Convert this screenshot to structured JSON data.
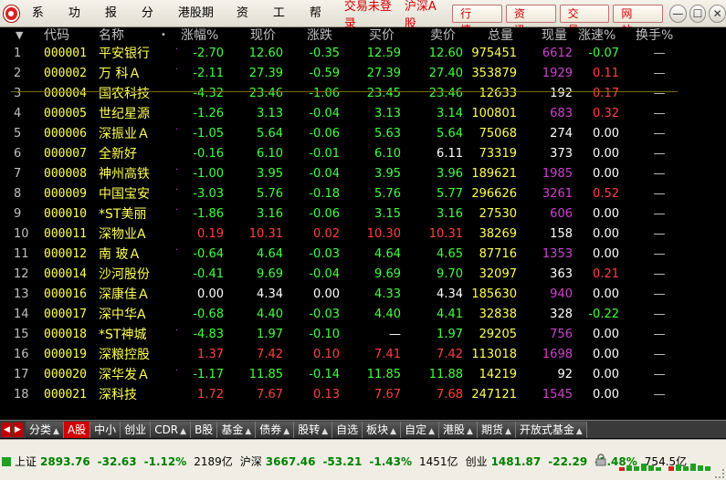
{
  "menubar": {
    "items": [
      "系统",
      "功能",
      "报价",
      "分析",
      "港股期货",
      "资讯",
      "工具",
      "帮助"
    ],
    "login_status": "交易未登录",
    "market_label": "沪深A股",
    "buttons": [
      "行 情",
      "资 讯",
      "交 易",
      "网 站"
    ],
    "window_controls": {
      "minimize": "—",
      "restore": "☐",
      "close": "✕"
    }
  },
  "table": {
    "headers": {
      "sort_arrow": "▼",
      "code": "代码",
      "name": "名称",
      "dot": "•",
      "change_pct": "涨幅%",
      "price": "现价",
      "change": "涨跌",
      "bid": "买价",
      "ask": "卖价",
      "volume": "总量",
      "current_vol": "现量",
      "speed": "涨速%",
      "turnover": "换手%"
    },
    "rows": [
      {
        "idx": "1",
        "code": "000001",
        "name": "平安银行",
        "dot": "·",
        "chg_pct": "-2.70",
        "price": "12.60",
        "chg": "-0.35",
        "bid": "12.59",
        "ask": "12.60",
        "vol": "975451",
        "cur": "6612",
        "spd": "-0.07",
        "turn": "—",
        "dir": "dn",
        "cur_color": "mag",
        "spd_dir": "dn"
      },
      {
        "idx": "2",
        "code": "000002",
        "name": "万 科Ａ",
        "dot": "·",
        "chg_pct": "-2.11",
        "price": "27.39",
        "chg": "-0.59",
        "bid": "27.39",
        "ask": "27.40",
        "vol": "353879",
        "cur": "1929",
        "spd": "0.11",
        "turn": "—",
        "dir": "dn",
        "cur_color": "mag",
        "spd_dir": "up"
      },
      {
        "idx": "3",
        "code": "000004",
        "name": "国农科技",
        "dot": "",
        "chg_pct": "-4.32",
        "price": "23.46",
        "chg": "-1.06",
        "bid": "23.45",
        "ask": "23.46",
        "vol": "12633",
        "cur": "192",
        "spd": "0.17",
        "turn": "—",
        "dir": "dn",
        "cur_color": "wht",
        "spd_dir": "up"
      },
      {
        "idx": "4",
        "code": "000005",
        "name": "世纪星源",
        "dot": "",
        "chg_pct": "-1.26",
        "price": "3.13",
        "chg": "-0.04",
        "bid": "3.13",
        "ask": "3.14",
        "vol": "100801",
        "cur": "683",
        "spd": "0.32",
        "turn": "—",
        "dir": "dn",
        "cur_color": "mag",
        "spd_dir": "up"
      },
      {
        "idx": "5",
        "code": "000006",
        "name": "深振业Ａ",
        "dot": "·",
        "chg_pct": "-1.05",
        "price": "5.64",
        "chg": "-0.06",
        "bid": "5.63",
        "ask": "5.64",
        "vol": "75068",
        "cur": "274",
        "spd": "0.00",
        "turn": "—",
        "dir": "dn",
        "cur_color": "wht",
        "spd_dir": "eq"
      },
      {
        "idx": "6",
        "code": "000007",
        "name": "全新好",
        "dot": "",
        "chg_pct": "-0.16",
        "price": "6.10",
        "chg": "-0.01",
        "bid": "6.10",
        "ask": "6.11",
        "vol": "73319",
        "cur": "373",
        "spd": "0.00",
        "turn": "—",
        "dir": "dn",
        "cur_color": "wht",
        "spd_dir": "eq",
        "ask_dir": "eq"
      },
      {
        "idx": "7",
        "code": "000008",
        "name": "神州高铁",
        "dot": "·",
        "chg_pct": "-1.00",
        "price": "3.95",
        "chg": "-0.04",
        "bid": "3.95",
        "ask": "3.96",
        "vol": "189621",
        "cur": "1985",
        "spd": "0.00",
        "turn": "—",
        "dir": "dn",
        "cur_color": "mag",
        "spd_dir": "eq"
      },
      {
        "idx": "8",
        "code": "000009",
        "name": "中国宝安",
        "dot": "·",
        "chg_pct": "-3.03",
        "price": "5.76",
        "chg": "-0.18",
        "bid": "5.76",
        "ask": "5.77",
        "vol": "296626",
        "cur": "3261",
        "spd": "0.52",
        "turn": "—",
        "dir": "dn",
        "cur_color": "mag",
        "spd_dir": "up"
      },
      {
        "idx": "9",
        "code": "000010",
        "name": "*ST美丽",
        "dot": "·",
        "chg_pct": "-1.86",
        "price": "3.16",
        "chg": "-0.06",
        "bid": "3.15",
        "ask": "3.16",
        "vol": "27530",
        "cur": "606",
        "spd": "0.00",
        "turn": "—",
        "dir": "dn",
        "cur_color": "mag",
        "spd_dir": "eq"
      },
      {
        "idx": "10",
        "code": "000011",
        "name": "深物业A",
        "dot": "",
        "chg_pct": "0.19",
        "price": "10.31",
        "chg": "0.02",
        "bid": "10.30",
        "ask": "10.31",
        "vol": "38269",
        "cur": "158",
        "spd": "0.00",
        "turn": "—",
        "dir": "up",
        "cur_color": "wht",
        "spd_dir": "eq"
      },
      {
        "idx": "11",
        "code": "000012",
        "name": "南 玻Ａ",
        "dot": "·",
        "chg_pct": "-0.64",
        "price": "4.64",
        "chg": "-0.03",
        "bid": "4.64",
        "ask": "4.65",
        "vol": "87716",
        "cur": "1353",
        "spd": "0.00",
        "turn": "—",
        "dir": "dn",
        "cur_color": "mag",
        "spd_dir": "eq"
      },
      {
        "idx": "12",
        "code": "000014",
        "name": "沙河股份",
        "dot": "",
        "chg_pct": "-0.41",
        "price": "9.69",
        "chg": "-0.04",
        "bid": "9.69",
        "ask": "9.70",
        "vol": "32097",
        "cur": "363",
        "spd": "0.21",
        "turn": "—",
        "dir": "dn",
        "cur_color": "wht",
        "spd_dir": "up"
      },
      {
        "idx": "13",
        "code": "000016",
        "name": "深康佳Ａ",
        "dot": "",
        "chg_pct": "0.00",
        "price": "4.34",
        "chg": "0.00",
        "bid": "4.33",
        "ask": "4.34",
        "vol": "185630",
        "cur": "940",
        "spd": "0.00",
        "turn": "—",
        "dir": "eq",
        "bid_dir": "dn",
        "cur_color": "mag",
        "spd_dir": "eq"
      },
      {
        "idx": "14",
        "code": "000017",
        "name": "深中华A",
        "dot": "",
        "chg_pct": "-0.68",
        "price": "4.40",
        "chg": "-0.03",
        "bid": "4.40",
        "ask": "4.41",
        "vol": "32838",
        "cur": "328",
        "spd": "-0.22",
        "turn": "—",
        "dir": "dn",
        "cur_color": "wht",
        "spd_dir": "dn"
      },
      {
        "idx": "15",
        "code": "000018",
        "name": "*ST神城",
        "dot": "·",
        "chg_pct": "-4.83",
        "price": "1.97",
        "chg": "-0.10",
        "bid": "—",
        "ask": "1.97",
        "vol": "29205",
        "cur": "756",
        "spd": "0.00",
        "turn": "—",
        "dir": "dn",
        "bid_dir": "eq",
        "cur_color": "mag",
        "spd_dir": "eq"
      },
      {
        "idx": "16",
        "code": "000019",
        "name": "深粮控股",
        "dot": "",
        "chg_pct": "1.37",
        "price": "7.42",
        "chg": "0.10",
        "bid": "7.41",
        "ask": "7.42",
        "vol": "113018",
        "cur": "1698",
        "spd": "0.00",
        "turn": "—",
        "dir": "up",
        "cur_color": "mag",
        "spd_dir": "eq"
      },
      {
        "idx": "17",
        "code": "000020",
        "name": "深华发Ａ",
        "dot": "·",
        "chg_pct": "-1.17",
        "price": "11.85",
        "chg": "-0.14",
        "bid": "11.85",
        "ask": "11.88",
        "vol": "14219",
        "cur": "92",
        "spd": "0.00",
        "turn": "—",
        "dir": "dn",
        "cur_color": "wht",
        "spd_dir": "eq"
      },
      {
        "idx": "18",
        "code": "000021",
        "name": "深科技",
        "dot": "",
        "chg_pct": "1.72",
        "price": "7.67",
        "chg": "0.13",
        "bid": "7.67",
        "ask": "7.68",
        "vol": "247121",
        "cur": "1545",
        "spd": "0.00",
        "turn": "—",
        "dir": "up",
        "cur_color": "mag",
        "spd_dir": "eq"
      }
    ]
  },
  "tabbar": {
    "tabs": [
      {
        "label": "分类",
        "arrow": "▲",
        "active": false
      },
      {
        "label": "A股",
        "arrow": "",
        "active": true
      },
      {
        "label": "中小",
        "arrow": "",
        "active": false
      },
      {
        "label": "创业",
        "arrow": "",
        "active": false
      },
      {
        "label": "CDR",
        "arrow": "▲",
        "active": false
      },
      {
        "label": "B股",
        "arrow": "",
        "active": false
      },
      {
        "label": "基金",
        "arrow": "▲",
        "active": false
      },
      {
        "label": "债券",
        "arrow": "▲",
        "active": false
      },
      {
        "label": "股转",
        "arrow": "▲",
        "active": false
      },
      {
        "label": "自选",
        "arrow": "",
        "active": false
      },
      {
        "label": "板块",
        "arrow": "▲",
        "active": false
      },
      {
        "label": "自定",
        "arrow": "▲",
        "active": false
      },
      {
        "label": "港股",
        "arrow": "▲",
        "active": false
      },
      {
        "label": "期货",
        "arrow": "▲",
        "active": false
      },
      {
        "label": "开放式基金",
        "arrow": "▲",
        "active": false
      }
    ]
  },
  "statusbar": {
    "indices": [
      {
        "name": "上证",
        "value": "2893.76",
        "change": "-32.63",
        "pct": "-1.12%",
        "amount": "2189亿"
      },
      {
        "name": "沪深",
        "value": "3667.46",
        "change": "-53.21",
        "pct": "-1.43%",
        "amount": "1451亿"
      },
      {
        "name": "创业",
        "value": "1481.87",
        "change": "-22.29",
        "pct": "-1.48%",
        "amount": "754.5亿"
      }
    ]
  },
  "colors": {
    "up": "#ff4040",
    "down": "#40ff40",
    "code": "#ffff55",
    "volume_mag": "#d040d0",
    "menu_red": "#d00000"
  }
}
